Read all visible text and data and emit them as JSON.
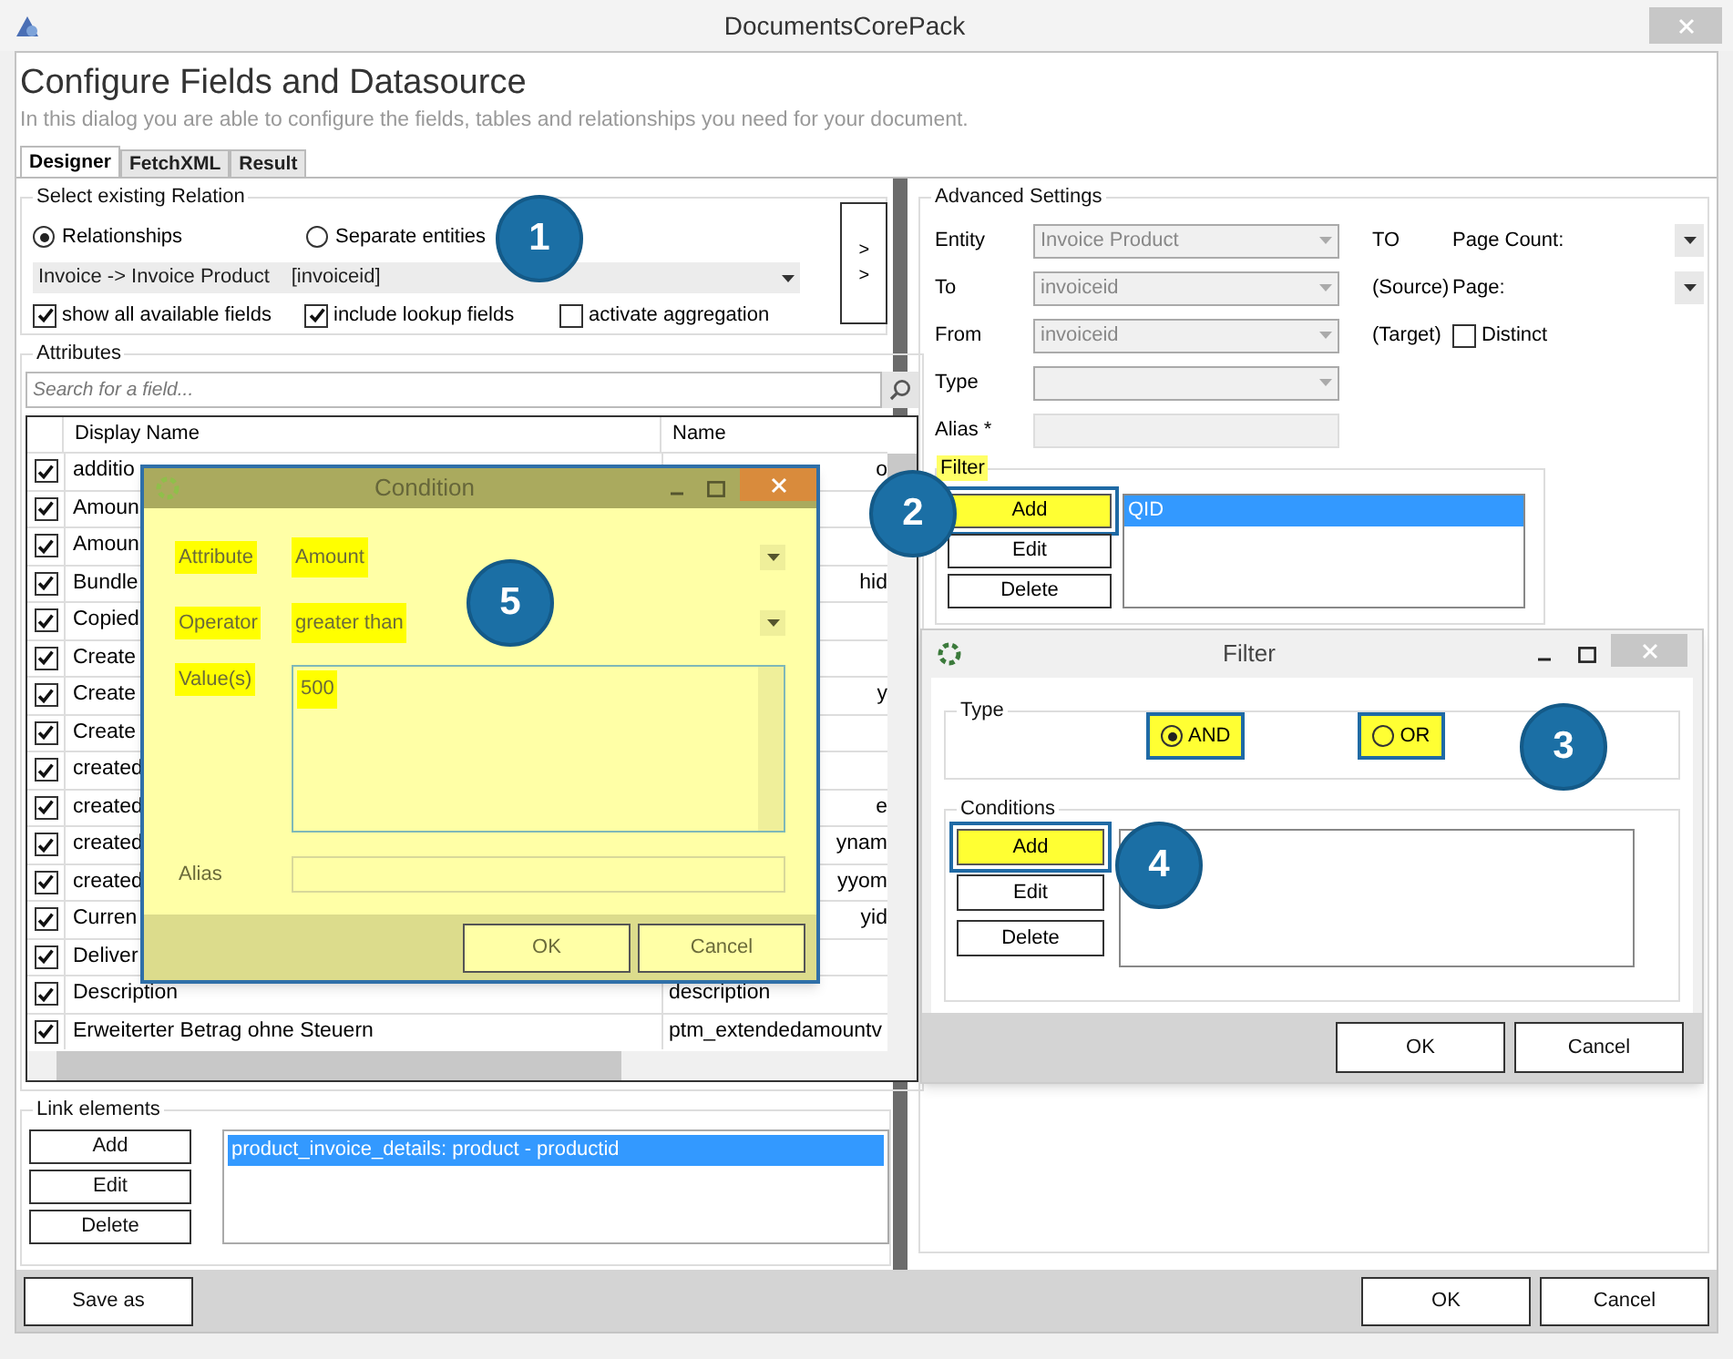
{
  "window": {
    "title": "DocumentsCorePack"
  },
  "header": {
    "title": "Configure Fields and Datasource",
    "subtitle": "In this dialog you are able to configure the fields, tables and relationships you need for your document."
  },
  "tabs": [
    {
      "label": "Designer",
      "selected": true
    },
    {
      "label": "FetchXML",
      "selected": false
    },
    {
      "label": "Result",
      "selected": false
    }
  ],
  "relation": {
    "legend": "Select existing Relation",
    "options": [
      {
        "label": "Relationships",
        "selected": true
      },
      {
        "label": "Separate entities",
        "selected": false
      }
    ],
    "dropdown": "Invoice -> Invoice Product",
    "dropdown_key": "[invoiceid]",
    "checkboxes": [
      {
        "label": "show all available fields",
        "checked": true
      },
      {
        "label": "include lookup fields",
        "checked": true
      },
      {
        "label": "activate aggregation",
        "checked": false
      }
    ],
    "move_button": ">>"
  },
  "attributes": {
    "legend": "Attributes",
    "search_placeholder": "Search for a field...",
    "columns": [
      "Display Name",
      "Name"
    ],
    "rows": [
      {
        "checked": true,
        "display_name": "additio",
        "name": "o",
        "partial": true
      },
      {
        "checked": true,
        "display_name": "Amoun",
        "partial": true
      },
      {
        "checked": true,
        "display_name": "Amoun",
        "partial": true
      },
      {
        "checked": true,
        "display_name": "Bundle",
        "name": "hid",
        "partial": true
      },
      {
        "checked": true,
        "display_name": "Copied",
        "partial": true
      },
      {
        "checked": true,
        "display_name": "Create",
        "partial": true
      },
      {
        "checked": true,
        "display_name": "Create",
        "name": "y",
        "partial": true
      },
      {
        "checked": true,
        "display_name": "Create",
        "partial": true
      },
      {
        "checked": true,
        "display_name": "created",
        "partial": true
      },
      {
        "checked": true,
        "display_name": "created",
        "name": "e",
        "partial": true
      },
      {
        "checked": true,
        "display_name": "created",
        "name": "ynam",
        "partial": true
      },
      {
        "checked": true,
        "display_name": "created",
        "name": "yyom",
        "partial": true
      },
      {
        "checked": true,
        "display_name": "Curren",
        "name": "yid",
        "partial": true
      },
      {
        "checked": true,
        "display_name": "Deliver",
        "partial": true
      },
      {
        "checked": true,
        "display_name": "Description",
        "name": "description",
        "partial": false
      },
      {
        "checked": true,
        "display_name": "Erweiterter Betrag ohne Steuern",
        "name": "ptm_extendedamountv",
        "partial": false
      }
    ]
  },
  "link_elements": {
    "legend": "Link elements",
    "buttons": [
      "Add",
      "Edit",
      "Delete"
    ],
    "items": [
      {
        "label": "product_invoice_details: product - productid",
        "selected": true
      }
    ]
  },
  "advanced": {
    "legend": "Advanced Settings",
    "fields": [
      {
        "label": "Entity",
        "value": "Invoice Product",
        "kind": "select",
        "note": "TO"
      },
      {
        "label": "To",
        "value": "invoiceid",
        "kind": "select",
        "note": "(Source)"
      },
      {
        "label": "From",
        "value": "invoiceid",
        "kind": "select",
        "note": "(Target)"
      },
      {
        "label": "Type",
        "kind": "select"
      },
      {
        "label": "Alias *",
        "kind": "text"
      }
    ],
    "page_settings": [
      {
        "label": "Page Count:",
        "kind": "select"
      },
      {
        "label": "Page:",
        "kind": "select"
      },
      {
        "label": "Distinct",
        "kind": "checkbox",
        "checked": false
      }
    ]
  },
  "filter": {
    "legend": "Filter",
    "buttons": [
      {
        "label": "Add",
        "highlighted": true
      },
      {
        "label": "Edit",
        "highlighted": false
      },
      {
        "label": "Delete",
        "highlighted": false
      }
    ],
    "items": [
      {
        "label": "QID",
        "selected": true
      }
    ]
  },
  "footer_buttons": [
    "Save as",
    "OK",
    "Cancel"
  ],
  "condition_dialog": {
    "title": "Condition",
    "fields": [
      {
        "label": "Attribute",
        "value": "Amount",
        "kind": "select",
        "highlighted": true
      },
      {
        "label": "Operator",
        "value": "greater than",
        "kind": "select",
        "highlighted": true
      },
      {
        "label": "Value(s)",
        "value": "500",
        "kind": "textarea",
        "highlighted": true
      },
      {
        "label": "Alias",
        "kind": "text",
        "highlighted": false
      }
    ],
    "buttons": [
      "OK",
      "Cancel"
    ]
  },
  "filter_dialog": {
    "title": "Filter",
    "type_legend": "Type",
    "type_options": [
      {
        "label": "AND",
        "selected": true,
        "highlighted": true
      },
      {
        "label": "OR",
        "selected": false,
        "highlighted": true
      }
    ],
    "conditions_legend": "Conditions",
    "buttons": [
      {
        "label": "Add",
        "highlighted": true
      },
      {
        "label": "Edit",
        "highlighted": false
      },
      {
        "label": "Delete",
        "highlighted": false
      }
    ],
    "footer_buttons": [
      "OK",
      "Cancel"
    ]
  },
  "callouts": [
    "1",
    "2",
    "3",
    "4",
    "5"
  ]
}
